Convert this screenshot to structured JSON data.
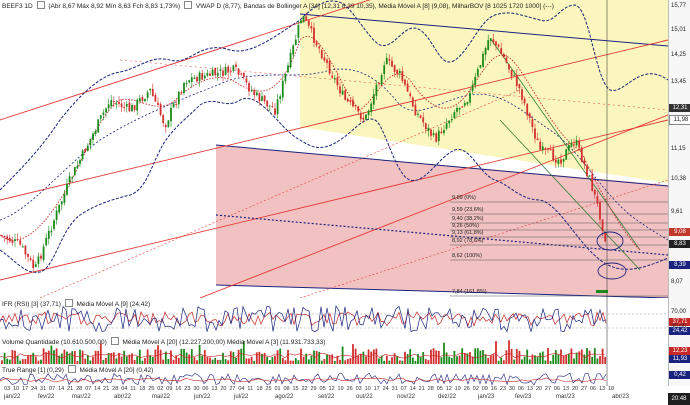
{
  "header": {
    "symbol": "BEEF3 1D",
    "ohlc": "(Abr 8,67 Máx 8,92 Mín 8,63 Fch 8,83 1,73%)",
    "indicators": "VWAP D (8,77), Bandas de Bollinger A [34] (12,31 8,39 10,35), Média Móvel A [8] (9,08), MilharBOV [8 1025 1720 1000] (---)"
  },
  "price_axis": {
    "labels": [
      "15,77",
      "15,01",
      "14,25",
      "13,45",
      "12,69",
      "11,98",
      "11,15",
      "10,38",
      "9,61",
      "8,83",
      "8,07"
    ],
    "tags": [
      {
        "text": "12,31",
        "color": "#333333"
      },
      {
        "text": "11,98",
        "color": "#ffffff"
      },
      {
        "text": "9,08",
        "color": "#c0392b"
      },
      {
        "text": "8,83",
        "color": "#222222"
      },
      {
        "text": "8,39",
        "color": "#1a237e"
      }
    ]
  },
  "fib_levels": [
    "9,89 (0%)",
    "9,59 (23,6%)",
    "9,40 (38,2%)",
    "9,26 (50%)",
    "9,13 (61,8%)",
    "8,92 (78,6%)",
    "8,62 (100%)",
    "7,84 (161,8%)"
  ],
  "ifr": {
    "title": "IFR (RSI) [3] (37,71)",
    "ma": "Média Móvel A [9] (24,42)",
    "axis": [
      "70,00",
      "30,00"
    ],
    "tags": [
      "37,71",
      "24,42"
    ]
  },
  "volume": {
    "title": "Volume Quantidade (10.610.500,00)",
    "ma1": "Média Móvel A [20] (12.227.200,00)",
    "ma2": "Média Móvel A [3] (11.931.733,33)",
    "tags": [
      "12,23",
      "11,93"
    ]
  },
  "tr": {
    "title": "True Range [1] (0,29)",
    "ma": "Média Móvel A [20] (0,42)",
    "tags": [
      "0,42"
    ]
  },
  "time_axis": {
    "months": [
      "jan/22",
      "fev/22",
      "mar/22",
      "abr/22",
      "mai/22",
      "jun/22",
      "jul/22",
      "ago/22",
      "set/22",
      "out/22",
      "nov/22",
      "dez/22",
      "jan/23",
      "fev/23",
      "mar/23",
      "abr/23"
    ],
    "days": [
      "03",
      "10",
      "17",
      "24",
      "31",
      "07",
      "14",
      "21",
      "28",
      "07",
      "14",
      "21",
      "28",
      "04",
      "11",
      "18",
      "25",
      "02",
      "09",
      "16",
      "23",
      "30",
      "06",
      "13",
      "20",
      "27",
      "04",
      "11",
      "18",
      "25",
      "01",
      "08",
      "15",
      "22",
      "29",
      "05",
      "12",
      "19",
      "26",
      "03",
      "10",
      "17",
      "24",
      "31",
      "07",
      "14",
      "21",
      "28",
      "05",
      "12",
      "19",
      "26",
      "02",
      "09",
      "16",
      "23",
      "30",
      "06",
      "13",
      "20",
      "27",
      "06",
      "13",
      "20",
      "27",
      "06",
      "13",
      "18"
    ]
  },
  "clock": "20:48",
  "colors": {
    "up": "#1b8a1b",
    "down": "#d32f2f",
    "band": "#1a237e",
    "yellow_zone": "#fbf6bd",
    "red_zone": "#f2c2c2"
  }
}
